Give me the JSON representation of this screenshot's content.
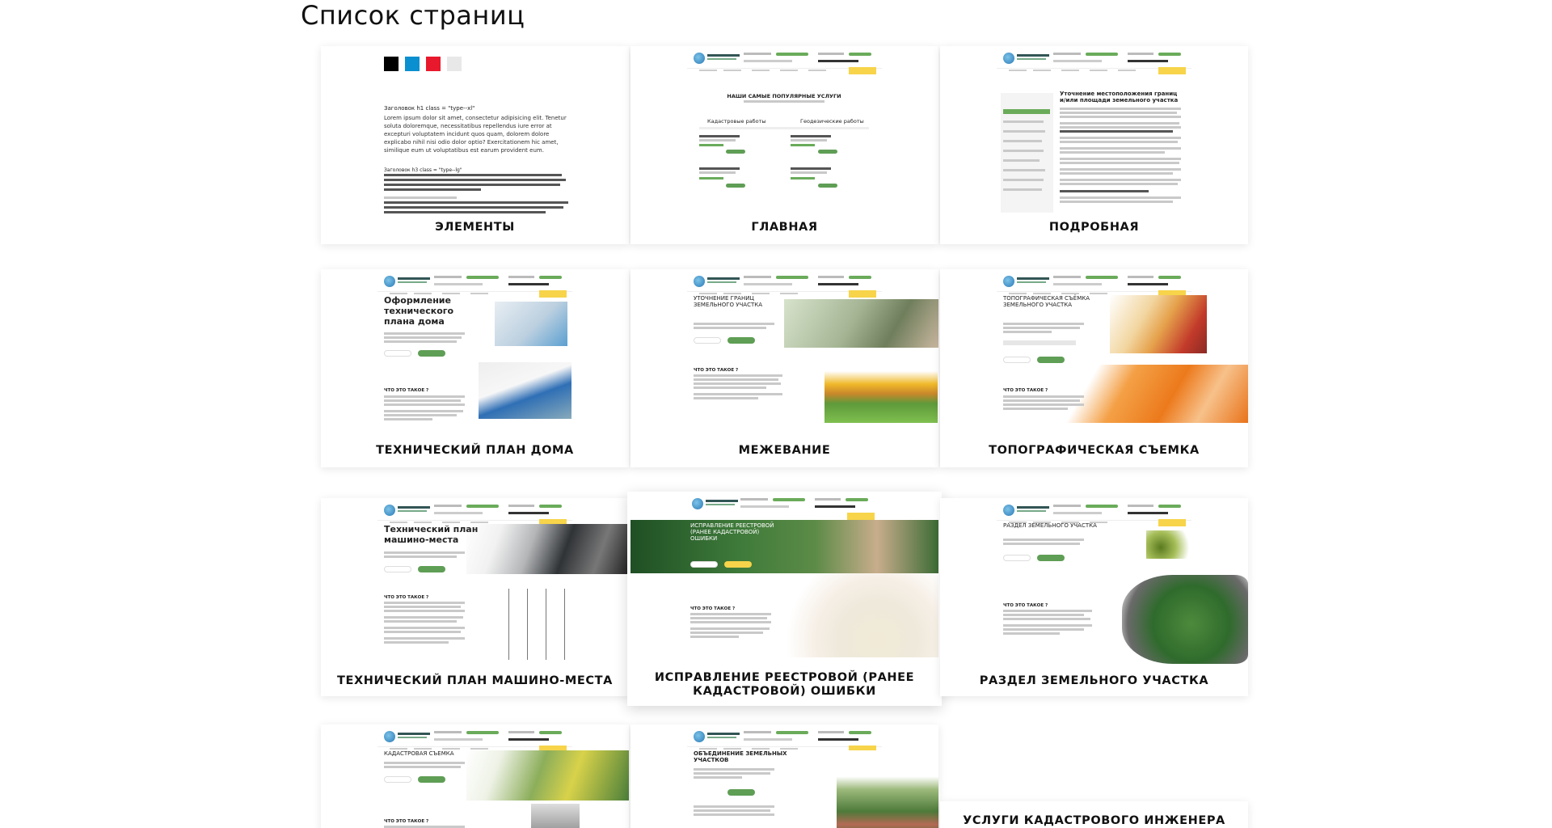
{
  "page": {
    "title": "Список страниц"
  },
  "cards": [
    {
      "label": "ЭЛЕМЕНТЫ"
    },
    {
      "label": "ГЛАВНАЯ"
    },
    {
      "label": "ПОДРОБНАЯ"
    },
    {
      "label": "ТЕХНИЧЕСКИЙ ПЛАН ДОМА"
    },
    {
      "label": "МЕЖЕВАНИЕ"
    },
    {
      "label": "ТОПОГРАФИЧЕСКАЯ СЪЕМКА"
    },
    {
      "label": "ТЕХНИЧЕСКИЙ ПЛАН МАШИНО-МЕСТА"
    },
    {
      "label": "ИСПРАВЛЕНИЕ РЕЕСТРОВОЙ (РАНЕЕ КАДАСТРОВОЙ) ОШИБКИ"
    },
    {
      "label": "РАЗДЕЛ ЗЕМЕЛЬНОГО УЧАСТКА"
    },
    {
      "label": ""
    },
    {
      "label": ""
    },
    {
      "label": "УСЛУГИ КАДАСТРОВОГО ИНЖЕНЕРА"
    }
  ],
  "thumbs": {
    "elements": {
      "swatch_colors": [
        "#000000",
        "#0a8fd0",
        "#e8192c",
        "#e8e8e8"
      ],
      "heading": "Заголовок h1 class = \"type--xl\"",
      "body": "Lorem ipsum dolor sit amet, consectetur adipisicing elit. Tenetur soluta doloremque, necessitatibus repellendus iure error at excepturi voluptatem incidunt quos quam, dolorem dolore explicabo nihil nisi odio dolor optio? Exercitationem hic amet, similique eum ut voluptatibus est earum provident eum.",
      "heading2": "Заголовок h3 class = \"type--lg\""
    },
    "main": {
      "heading": "НАШИ САМЫЕ ПОПУЛЯРНЫЕ УСЛУГИ",
      "col1": "Кадастровые работы",
      "col2": "Геодезические работы"
    },
    "detail": {
      "heading": "Уточнение местоположения границ и/или площади земельного участка"
    },
    "house": {
      "heading": "Оформление технического плана дома",
      "sub": "ЧТО ЭТО ТАКОЕ ?"
    },
    "survey": {
      "heading": "УТОЧНЕНИЕ ГРАНИЦ ЗЕМЕЛЬНОГО УЧАСТКА",
      "sub": "ЧТО ЭТО ТАКОЕ ?"
    },
    "topo": {
      "heading": "ТОПОГРАФИЧЕСКАЯ СЪЁМКА ЗЕМЕЛЬНОГО УЧАСТКА",
      "sub": "ЧТО ЭТО ТАКОЕ ?"
    },
    "parking": {
      "heading": "Технический план машино-места",
      "sub": "ЧТО ЭТО ТАКОЕ ?"
    },
    "error": {
      "heading": "ИСПРАВЛЕНИЕ РЕЕСТРОВОЙ (РАНЕЕ КАДАСТРОВОЙ) ОШИБКИ",
      "sub": "ЧТО ЭТО ТАКОЕ ?"
    },
    "split": {
      "heading": "РАЗДЕЛ ЗЕМЕЛЬНОГО УЧАСТКА",
      "sub": "ЧТО ЭТО ТАКОЕ ?"
    },
    "cadastral": {
      "heading": "КАДАСТРОВАЯ СЪЕМКА",
      "sub": "ЧТО ЭТО ТАКОЕ ?"
    },
    "merge": {
      "heading": "ОБЪЕДИНЕНИЕ ЗЕМЕЛЬНЫХ УЧАСТКОВ"
    }
  }
}
